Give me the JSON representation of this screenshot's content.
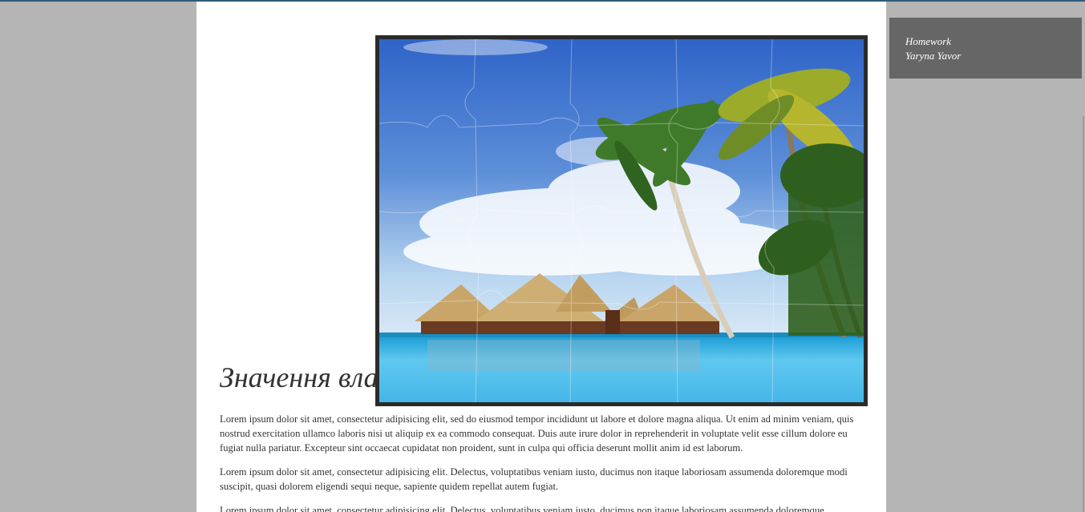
{
  "article": {
    "title": "Значення вла",
    "paragraphs": [
      "Lorem ipsum dolor sit amet, consectetur adipisicing elit, sed do eiusmod tempor incididunt ut labore et dolore magna aliqua. Ut enim ad minim veniam, quis nostrud exercitation ullamco laboris nisi ut aliquip ex ea commodo consequat. Duis aute irure dolor in reprehenderit in voluptate velit esse cillum dolore eu fugiat nulla pariatur. Excepteur sint occaecat cupidatat non proident, sunt in culpa qui officia deserunt mollit anim id est laborum.",
      "Lorem ipsum dolor sit amet, consectetur adipisicing elit. Delectus, voluptatibus veniam iusto, ducimus non itaque laboriosam assumenda doloremque modi suscipit, quasi dolorem eligendi sequi neque, sapiente quidem repellat autem fugiat.",
      "Lorem ipsum dolor sit amet, consectetur adipisicing elit. Delectus, voluptatibus veniam iusto, ducimus non itaque laboriosam assumenda doloremque"
    ]
  },
  "info_box": {
    "line1": "Homework",
    "line2": "Yaryna Yavor"
  },
  "puzzle": {
    "icon": "tropical-resort-puzzle-image",
    "colors": {
      "frame": "#2b2b2b",
      "sky_top": "#2f64c8",
      "sky_bottom": "#b9d6f0",
      "water": "#4cc0ec",
      "thatch": "#c9a56a",
      "palm": "#3f7a2a"
    }
  },
  "colors": {
    "background": "#b5b5b5",
    "page": "#ffffff",
    "info_box": "#666666",
    "text": "#333333"
  }
}
